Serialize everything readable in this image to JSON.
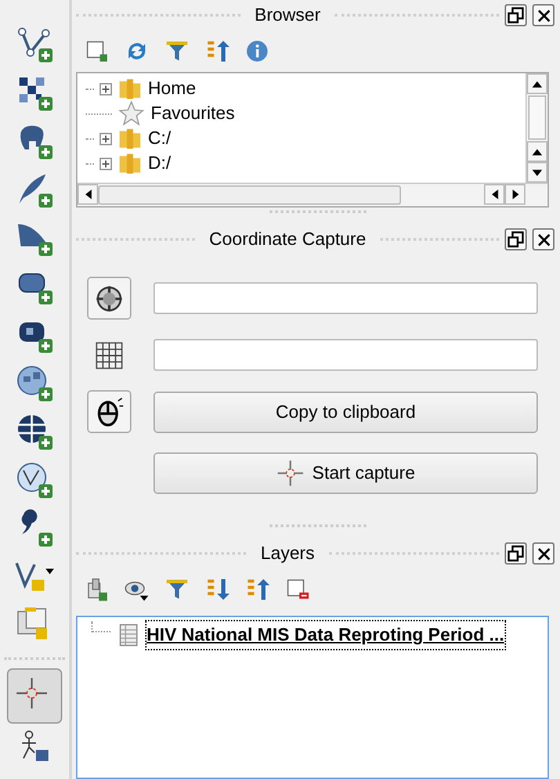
{
  "toolbar": {
    "groups": [
      [
        {
          "selected": false
        },
        {
          "selected": false
        },
        {
          "selected": false
        },
        {
          "selected": false
        },
        {
          "selected": false
        },
        {
          "selected": false
        },
        {
          "selected": false
        },
        {
          "selected": false
        },
        {
          "selected": false
        },
        {
          "selected": false
        },
        {
          "selected": false
        },
        {
          "selected": false
        },
        {
          "selected": false
        }
      ],
      [
        {
          "selected": true
        },
        {
          "selected": false
        }
      ]
    ]
  },
  "browser": {
    "title": "Browser",
    "tree": [
      {
        "label": "Home",
        "expandable": true
      },
      {
        "label": "Favourites",
        "expandable": false
      },
      {
        "label": "C:/",
        "expandable": true
      },
      {
        "label": "D:/",
        "expandable": true
      }
    ]
  },
  "coordinate_capture": {
    "title": "Coordinate Capture",
    "buttons": [
      {
        "label": "Copy to clipboard"
      },
      {
        "label": "Start capture"
      }
    ]
  },
  "layers": {
    "title": "Layers",
    "items": [
      {
        "label": "HIV National MIS Data Reproting Period ...",
        "selected": true
      }
    ]
  }
}
